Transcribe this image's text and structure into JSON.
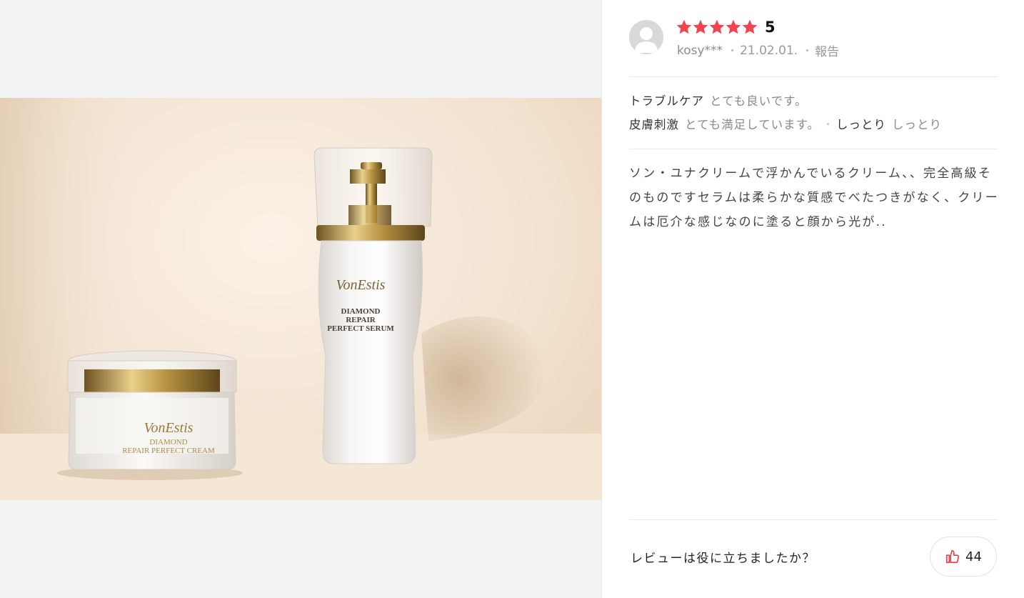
{
  "review": {
    "rating": "5",
    "user": "kosy***",
    "date": "21.02.01.",
    "report_label": "報告",
    "attributes": [
      {
        "key": "トラブルケア",
        "value": "とても良いです。"
      },
      {
        "key": "皮膚刺激",
        "value": "とても満足しています。"
      },
      {
        "key": "しっとり",
        "value": "しっとり"
      }
    ],
    "body": "ソン・ユナクリームで浮かんでいるクリーム、、完全高級そのものですセラムは柔らかな質感でべたつきがなく、クリームは厄介な感じなのに塗ると顔から光が.."
  },
  "feedback": {
    "question": "レビューは役に立ちましたか？",
    "like_count": "44"
  },
  "photo": {
    "serum_brand": "VonEstis",
    "serum_name_1": "DIAMOND",
    "serum_name_2": "REPAIR",
    "serum_name_3": "PERFECT SERUM",
    "cream_brand": "VonEstis",
    "cream_name_1": "DIAMOND",
    "cream_name_2": "REPAIR PERFECT CREAM"
  },
  "colors": {
    "star": "#f2444f",
    "like_icon": "#e8404a"
  },
  "icons": {
    "avatar": "default-user-avatar-icon",
    "star": "star-icon",
    "like": "thumbs-up-icon"
  }
}
